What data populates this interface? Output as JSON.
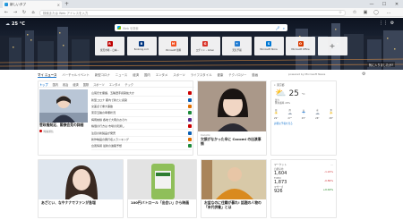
{
  "browser": {
    "tab_title": "新しいタブ",
    "new_tab": "+",
    "address_placeholder": "検索または Web アドレスを入力",
    "controls": {
      "minimize": "—",
      "maximize": "☐",
      "close": "✕"
    }
  },
  "hero": {
    "weather_temp": "25 °C",
    "search_placeholder": "Web を検索",
    "caption": "気に入りましたか?",
    "quick_links": [
      {
        "label": "楽天市場 – 日本...",
        "icon": "R",
        "color": "#bf0000"
      },
      {
        "label": "Booking.com",
        "icon": "B",
        "color": "#003580"
      },
      {
        "label": "Microsoft 無料",
        "icon": "M",
        "color": "#f25022"
      },
      {
        "label": "ログイン – Gmail",
        "icon": "G",
        "color": "#d93025"
      },
      {
        "label": "天気予報",
        "icon": "☀",
        "color": "#1f7ad1"
      },
      {
        "label": "Microsoft Store",
        "icon": "S",
        "color": "#0078d4"
      },
      {
        "label": "Microsoft Office",
        "icon": "O",
        "color": "#d83b01"
      },
      {
        "label": "サイトを追加",
        "icon": "+",
        "color": "#888"
      }
    ]
  },
  "categories": {
    "items": [
      "マイ ニュース",
      "バーチャルイベント",
      "新型コロナ",
      "ニュース",
      "経済",
      "国内",
      "エンタメ",
      "スポーツ",
      "ライフスタイル",
      "健康",
      "テクノロジー",
      "動画",
      "天気",
      "ショッピング"
    ],
    "powered": "powered by Microsoft News"
  },
  "topnews": {
    "tabs": [
      "トップ",
      "国内",
      "政治",
      "経済",
      "国際",
      "スポーツ",
      "エンタメ",
      "テック",
      "映画",
      "動画"
    ],
    "lead_title": "菅政権発足、閣僚会見の詳細",
    "lead_source": "時事通信",
    "list": [
      "山尾氏を擁護、五輪選手感染拡大か",
      "新型コロナ 都内で新たに感染",
      "交差点で重大事故",
      "東京五輪の準備状況",
      "梅雨前線 各地で大雨のおそれ",
      "株価の行方は 市場の見通し",
      "注目の新製品が発売",
      "新作映画の興行収入ランキング",
      "台風情報 最新の進路予想"
    ]
  },
  "feature": {
    "title": "欠損がなかった辛に Cocomi の出演事情",
    "source": "Cocomi"
  },
  "weather": {
    "location": "東京都",
    "temp": "25",
    "unit": "°C",
    "detail": "曇り\n降水確率 20%",
    "days": [
      {
        "d": "日",
        "i": "☀",
        "t": "29°"
      },
      {
        "d": "月",
        "i": "☁",
        "t": "27°"
      },
      {
        "d": "火",
        "i": "☂",
        "t": "25°"
      },
      {
        "d": "水",
        "i": "☁",
        "t": "26°"
      },
      {
        "d": "木",
        "i": "☀",
        "t": "28°"
      }
    ],
    "link": "詳細な予報を見る"
  },
  "bottom_stories": [
    {
      "title": "あざとい、なやナナでファンが急増",
      "source": "Yahoo!"
    },
    {
      "title": "100円バトロール「出会い」から映画",
      "source": "Hochi"
    },
    {
      "title": "お盆なのに住職が暴れ! 話題の人物の「末代供養」とは",
      "source": "News"
    }
  ],
  "finance": {
    "title": "マーケット",
    "rows": [
      {
        "name": "日経平均",
        "value": "1,604",
        "change": "-1.22%"
      },
      {
        "name": "TOPIX",
        "value": "1,873",
        "change": "-0.89%"
      },
      {
        "name": "マザーズ",
        "value": "926",
        "change": "+0.44%"
      }
    ]
  },
  "colors": {
    "accent": "#1f7ad1",
    "down": "#d13438",
    "up": "#107c10"
  }
}
